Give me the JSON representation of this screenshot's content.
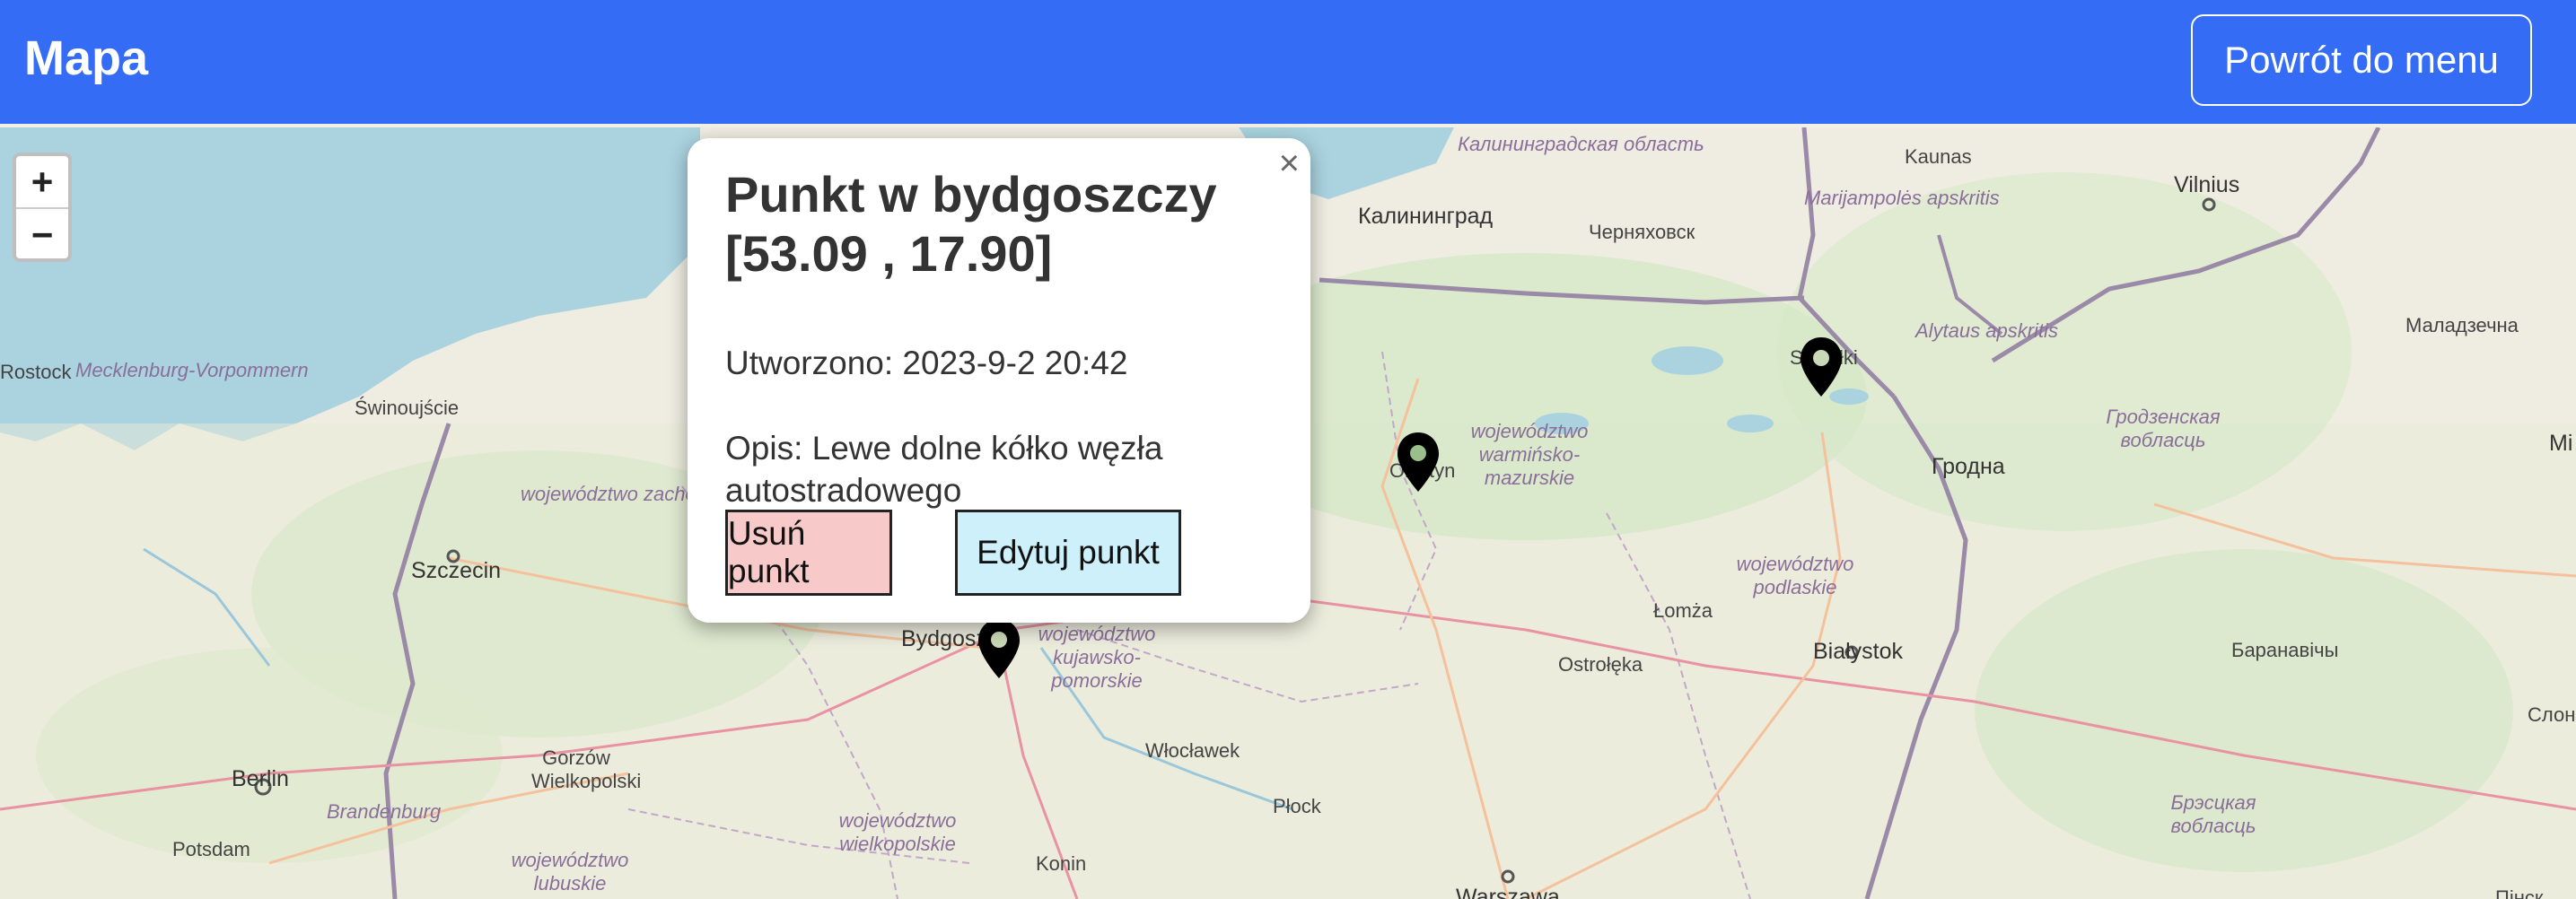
{
  "navbar": {
    "brand": "Mapa",
    "back_button": "Powrót do menu"
  },
  "zoom": {
    "in": "+",
    "out": "−"
  },
  "popup": {
    "close": "×",
    "title_line1": "Punkt w bydgoszczy",
    "title_line2": "[53.09 , 17.90]",
    "created": "Utworzono: 2023-9-2 20:42",
    "description": "Opis: Lewe dolne kółko węzła autostradowego",
    "delete_button": "Usuń punkt",
    "edit_button": "Edytuj punkt"
  },
  "map_labels": {
    "kaliningrad_oblast": "Калининградская область",
    "kaliningrad": "Калининград",
    "chernyakhovsk": "Черняховск",
    "marijampoles": "Marijampolės apskritis",
    "kaunas": "Kaunas",
    "vilnius": "Vilnius",
    "alytaus": "Alytaus apskritis",
    "maladzyechna": "Маладзечна",
    "mecklenburg": "Mecklenburg-Vorpommern",
    "swinoujscie": "Świnoujście",
    "zachodniopomorskie": "województwo zachodniopomorskie",
    "szczecin": "Szczecin",
    "warminsko": "województwo warmińsko-mazurskie",
    "olsztyn": "Olsztyn",
    "suwalki": "Suwałki",
    "grodno_region": "Гродзенская вобласць",
    "grodno": "Гродна",
    "podlaskie": "województwo podlaskie",
    "lomza": "Łomża",
    "ostroleka": "Ostrołęka",
    "bialystok": "Białystok",
    "baranavichy": "Баранавічы",
    "bydgoszcz": "Bydgoszcz",
    "kujawsko": "województwo kujawsko-pomorskie",
    "gorzow": "Gorzów Wielkopolski",
    "berlin": "Berlin",
    "brandenburg": "Brandenburg",
    "wloclawek": "Włocławek",
    "plock": "Płock",
    "brest_region": "Брэсцкая вобласць",
    "wielkopolskie": "województwo wielkopolskie",
    "lubuskie": "województwo lubuskie",
    "potsdam": "Potsdam",
    "konin": "Konin",
    "warszawa": "Warszawa",
    "rostock": "Rostock",
    "pinsk": "Пінск",
    "slonim": "Слонім",
    "minsk": "Мі"
  }
}
